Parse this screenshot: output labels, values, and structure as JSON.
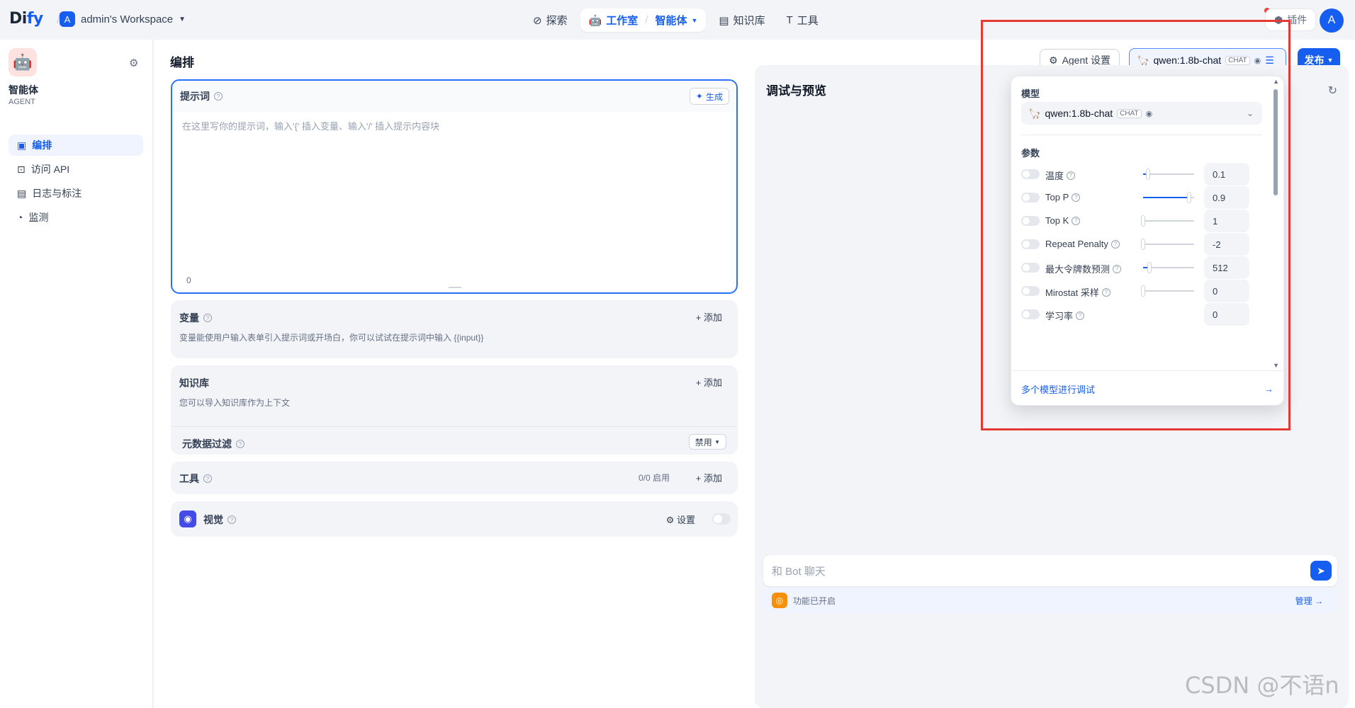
{
  "topbar": {
    "logo_a": "Di",
    "logo_b": "fy",
    "workspace_initial": "A",
    "workspace_name": "admin's Workspace",
    "nav": {
      "explore": "探索",
      "studio": "工作室",
      "agent": "智能体",
      "kb": "知识库",
      "tools": "工具"
    },
    "plugin": "插件",
    "user_initial": "A"
  },
  "sidebar": {
    "app_name": "智能体",
    "app_type": "AGENT",
    "items": [
      {
        "label": "编排",
        "icon": "layout-icon"
      },
      {
        "label": "访问 API",
        "icon": "terminal-icon"
      },
      {
        "label": "日志与标注",
        "icon": "log-icon"
      },
      {
        "label": "监测",
        "icon": "gauge-icon"
      }
    ]
  },
  "main": {
    "title": "编排",
    "agent_settings": "Agent 设置",
    "model_name": "qwen:1.8b-chat",
    "model_badge": "CHAT",
    "publish": "发布",
    "prompt": {
      "title": "提示词",
      "generate": "生成",
      "placeholder": "在这里写你的提示词，输入'{' 插入变量、输入'/' 插入提示内容块",
      "count": "0"
    },
    "variables": {
      "title": "变量",
      "add": "添加",
      "desc": "变量能使用户输入表单引入提示词或开场白，你可以试试在提示词中输入 {{input}}"
    },
    "knowledge": {
      "title": "知识库",
      "add": "添加",
      "desc": "您可以导入知识库作为上下文",
      "meta_filter": "元数据过滤",
      "meta_value": "禁用"
    },
    "tools": {
      "title": "工具",
      "status": "0/0 启用",
      "add": "添加"
    },
    "vision": {
      "title": "视觉",
      "settings": "设置"
    }
  },
  "debug": {
    "title": "调试与预览",
    "chat_placeholder": "和 Bot 聊天",
    "features": "功能已开启",
    "manage": "管理"
  },
  "model_panel": {
    "model_label": "模型",
    "model_name": "qwen:1.8b-chat",
    "model_badge": "CHAT",
    "params_label": "参数",
    "params": [
      {
        "name": "温度",
        "value": "0.1",
        "level": 0.1
      },
      {
        "name": "Top P",
        "value": "0.9",
        "level": 0.9
      },
      {
        "name": "Top K",
        "value": "1",
        "level": 0.0
      },
      {
        "name": "Repeat Penalty",
        "value": "-2",
        "level": 0.0
      },
      {
        "name": "最大令牌数预测",
        "value": "512",
        "level": 0.12
      },
      {
        "name": "Mirostat 采样",
        "value": "0",
        "level": 0.0
      },
      {
        "name": "学习率",
        "value": "0",
        "level": null
      }
    ],
    "multi_model": "多个模型进行调试"
  },
  "watermark": "CSDN @不语n",
  "colors": {
    "accent": "#155eef",
    "highlight_box": "#e53935"
  }
}
